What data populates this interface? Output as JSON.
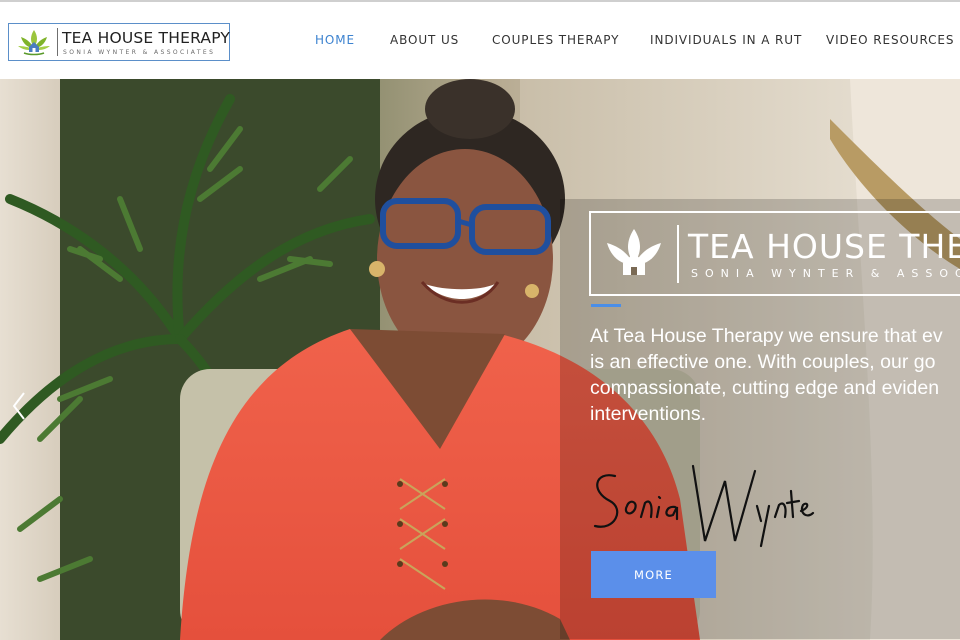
{
  "brand": {
    "title": "TEA HOUSE THERAPY",
    "subtitle": "SONIA WYNTER & ASSOCIATES",
    "logo_icon": "lotus-house-icon"
  },
  "nav": {
    "items": [
      {
        "label": "HOME",
        "active": true
      },
      {
        "label": "ABOUT US",
        "active": false
      },
      {
        "label": "COUPLES THERAPY",
        "active": false
      },
      {
        "label": "INDIVIDUALS IN A RUT",
        "active": false
      },
      {
        "label": "VIDEO RESOURCES",
        "active": false
      }
    ],
    "active_color": "#3d83d0"
  },
  "hero": {
    "overlay_title": "TEA HOUSE THERA",
    "overlay_subtitle": "SONIA WYNTER & ASSOCI",
    "tagline_lines": [
      "At Tea House Therapy we ensure that ev",
      "is an effective one. With couples, our go",
      "compassionate, cutting edge and eviden",
      "interventions."
    ],
    "signature": "Sonia Wynter",
    "more_label": "MORE",
    "prev_icon": "chevron-left-icon",
    "accent_color": "#4a8ee8",
    "button_color": "#5b8fea"
  }
}
